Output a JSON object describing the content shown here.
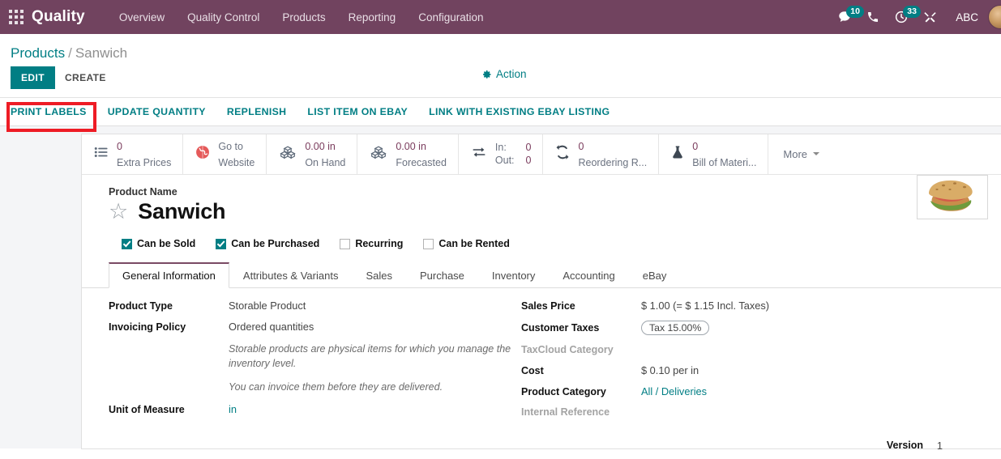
{
  "navbar": {
    "apps_icon": "apps-grid-icon",
    "brand": "Quality",
    "menus": [
      "Overview",
      "Quality Control",
      "Products",
      "Reporting",
      "Configuration"
    ],
    "messages_icon": "chat-bubble-icon",
    "messages_count": "10",
    "phone_icon": "phone-icon",
    "activities_icon": "clock-icon",
    "activities_count": "33",
    "tools_icon": "wrench-screwdriver-icon",
    "user_name": "ABC",
    "avatar": "user-avatar",
    "bg_color": "#71435f",
    "badge_color": "#017e84"
  },
  "breadcrumb": {
    "root": "Products",
    "separator": "/",
    "current": "Sanwich"
  },
  "controls": {
    "edit_label": "EDIT",
    "create_label": "CREATE",
    "action_label": "Action",
    "action_icon": "gear-icon",
    "edit_color": "#017e84"
  },
  "action_buttons": [
    "PRINT LABELS",
    "UPDATE QUANTITY",
    "REPLENISH",
    "LIST ITEM ON EBAY",
    "LINK WITH EXISTING EBAY LISTING"
  ],
  "annotation": {
    "target": "PRINT LABELS",
    "color": "#ee1c25"
  },
  "stat_buttons": [
    {
      "icon": "list-icon",
      "value": "0",
      "label": "Extra Prices"
    },
    {
      "icon": "globe-icon",
      "value": "Go to",
      "label": "Website"
    },
    {
      "icon": "boxes-icon",
      "value": "0.00 in",
      "label": "On Hand"
    },
    {
      "icon": "boxes-icon",
      "value": "0.00 in",
      "label": "Forecasted"
    },
    {
      "icon": "exchange-icon",
      "in_key": "In:",
      "in_value": "0",
      "out_key": "Out:",
      "out_value": "0"
    },
    {
      "icon": "refresh-icon",
      "value": "0",
      "label": "Reordering R..."
    },
    {
      "icon": "flask-icon",
      "value": "0",
      "label": "Bill of Materi..."
    }
  ],
  "more_button": {
    "label": "More",
    "icon": "chevron-down-icon"
  },
  "product": {
    "name_label": "Product Name",
    "name": "Sanwich",
    "favorite_icon": "star-icon",
    "image": "sandwich-photo",
    "checkboxes": [
      {
        "label": "Can be Sold",
        "checked": true
      },
      {
        "label": "Can be Purchased",
        "checked": true
      },
      {
        "label": "Recurring",
        "checked": false
      },
      {
        "label": "Can be Rented",
        "checked": false
      }
    ]
  },
  "tabs": [
    {
      "label": "General Information",
      "active": true
    },
    {
      "label": "Attributes & Variants",
      "active": false
    },
    {
      "label": "Sales",
      "active": false
    },
    {
      "label": "Purchase",
      "active": false
    },
    {
      "label": "Inventory",
      "active": false
    },
    {
      "label": "Accounting",
      "active": false
    },
    {
      "label": "eBay",
      "active": false
    }
  ],
  "form": {
    "left": {
      "product_type_label": "Product Type",
      "product_type_value": "Storable Product",
      "invoicing_policy_label": "Invoicing Policy",
      "invoicing_policy_value": "Ordered quantities",
      "help_1": "Storable products are physical items for which you manage the inventory level.",
      "help_2": "You can invoice them before they are delivered.",
      "uom_label": "Unit of Measure",
      "uom_value": "in"
    },
    "right": {
      "sales_price_label": "Sales Price",
      "sales_price_value": "$ 1.00  (= $ 1.15 Incl. Taxes)",
      "customer_taxes_label": "Customer Taxes",
      "customer_taxes_value": "Tax 15.00%",
      "taxcloud_label": "TaxCloud Category",
      "taxcloud_value": "",
      "cost_label": "Cost",
      "cost_value": "$ 0.10  per in",
      "product_category_label": "Product Category",
      "product_category_value": "All / Deliveries",
      "internal_reference_label": "Internal Reference",
      "internal_reference_value": "",
      "version_label": "Version",
      "version_value": "1"
    }
  }
}
